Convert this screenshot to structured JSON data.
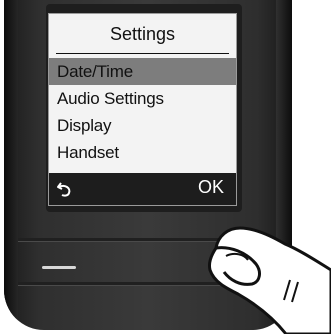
{
  "screen": {
    "title": "Settings",
    "menu": [
      {
        "label": "Date/Time",
        "selected": true
      },
      {
        "label": "Audio Settings",
        "selected": false
      },
      {
        "label": "Display",
        "selected": false
      },
      {
        "label": "Handset",
        "selected": false
      }
    ],
    "softkeys": {
      "left_icon": "back-arrow-icon",
      "right_label": "OK"
    }
  },
  "colors": {
    "phone_body": "#2f2f2f",
    "screen_bg": "#f3f3f3",
    "selection": "#7d7d7d",
    "softbar": "#1d1d1d"
  }
}
